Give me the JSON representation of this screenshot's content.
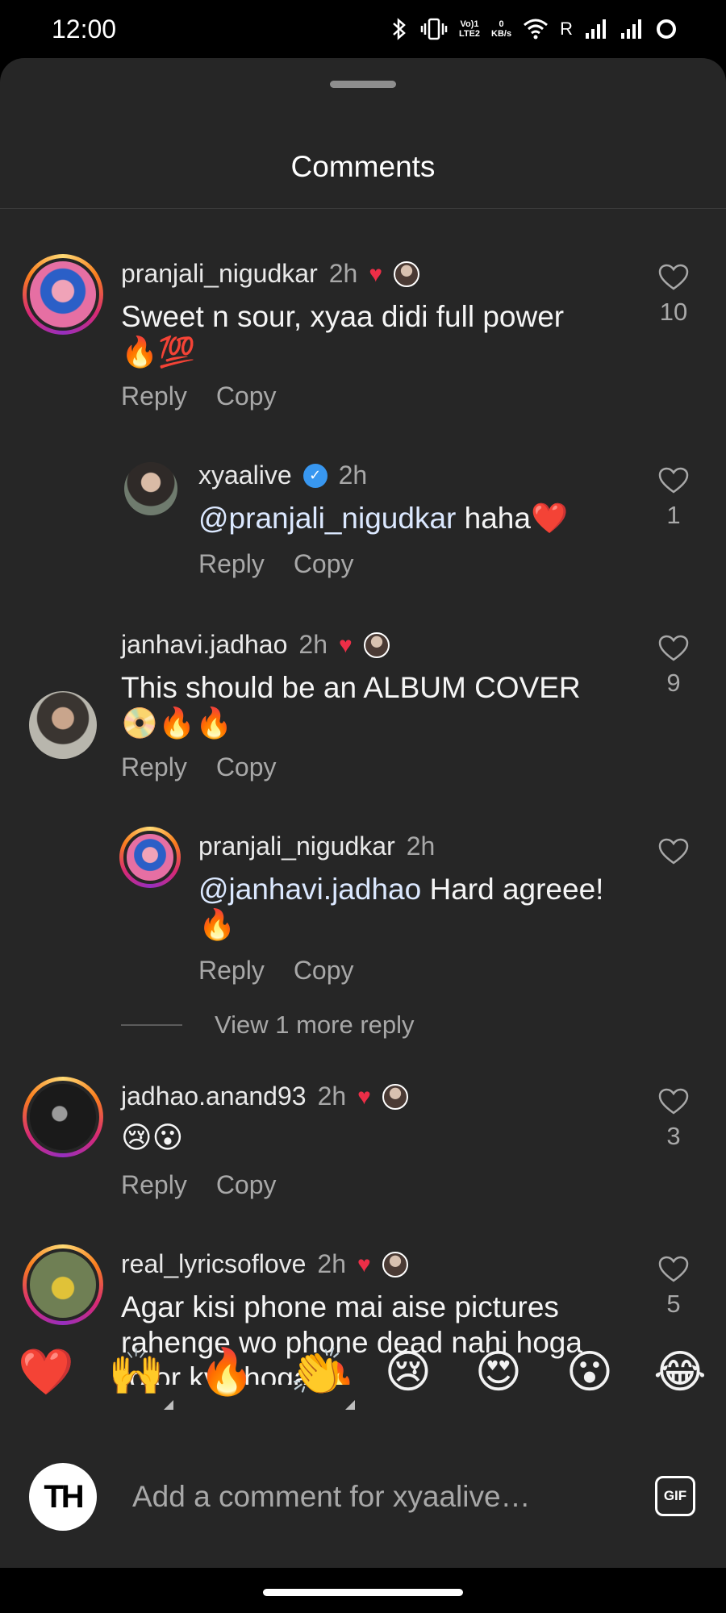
{
  "status_bar": {
    "time": "12:00",
    "bluetooth_icon": "bluetooth-icon",
    "vibrate_icon": "vibrate-icon",
    "volte_label": "Vo) LTE1\nLTE2",
    "data_speed": "0\nKB/s",
    "roaming": "R"
  },
  "sheet": {
    "title": "Comments"
  },
  "comments": [
    {
      "username": "pranjali_nigudkar",
      "time": "2h",
      "creator_liked": true,
      "text_line1": "Sweet n sour, xyaa didi full power",
      "text_line2": "🔥💯",
      "reply": "Reply",
      "copy": "Copy",
      "likes": "10"
    },
    {
      "username": "xyaalive",
      "verified": true,
      "time": "2h",
      "mention": "@pranjali_nigudkar",
      "text": " haha❤️",
      "reply": "Reply",
      "copy": "Copy",
      "likes": "1"
    },
    {
      "username": "janhavi.jadhao",
      "time": "2h",
      "creator_liked": true,
      "text_line1": "This should be an ALBUM COVER",
      "text_line2": "📀🔥🔥",
      "reply": "Reply",
      "copy": "Copy",
      "likes": "9"
    },
    {
      "username": "pranjali_nigudkar",
      "time": "2h",
      "mention": "@janhavi.jadhao",
      "text": " Hard agreee!",
      "text_line2": "🔥",
      "reply": "Reply",
      "copy": "Copy",
      "likes": ""
    },
    {
      "username": "jadhao.anand93",
      "time": "2h",
      "creator_liked": true,
      "text_line1": "😢😮",
      "reply": "Reply",
      "copy": "Copy",
      "likes": "3"
    },
    {
      "username": "real_lyricsoflove",
      "time": "2h",
      "creator_liked": true,
      "text_line1": "Agar kisi phone mai aise pictures",
      "text_line2": "rahenge wo phone dead nahi hoga",
      "text_line3": "to or kya hoga 🔥",
      "likes": "5"
    }
  ],
  "view_more_replies": "View 1 more reply",
  "emoji_bar": [
    "❤️",
    "🙌",
    "🔥",
    "👏",
    "😢",
    "😍",
    "😮",
    "😂"
  ],
  "composer": {
    "avatar_initials": "TH",
    "placeholder": "Add a comment for xyaalive…",
    "gif_label": "GIF"
  },
  "colors": {
    "sheet_bg": "#262626",
    "secondary_text": "#a8a8a8",
    "heart_red": "#ed2e47",
    "verified_blue": "#3897f0"
  }
}
